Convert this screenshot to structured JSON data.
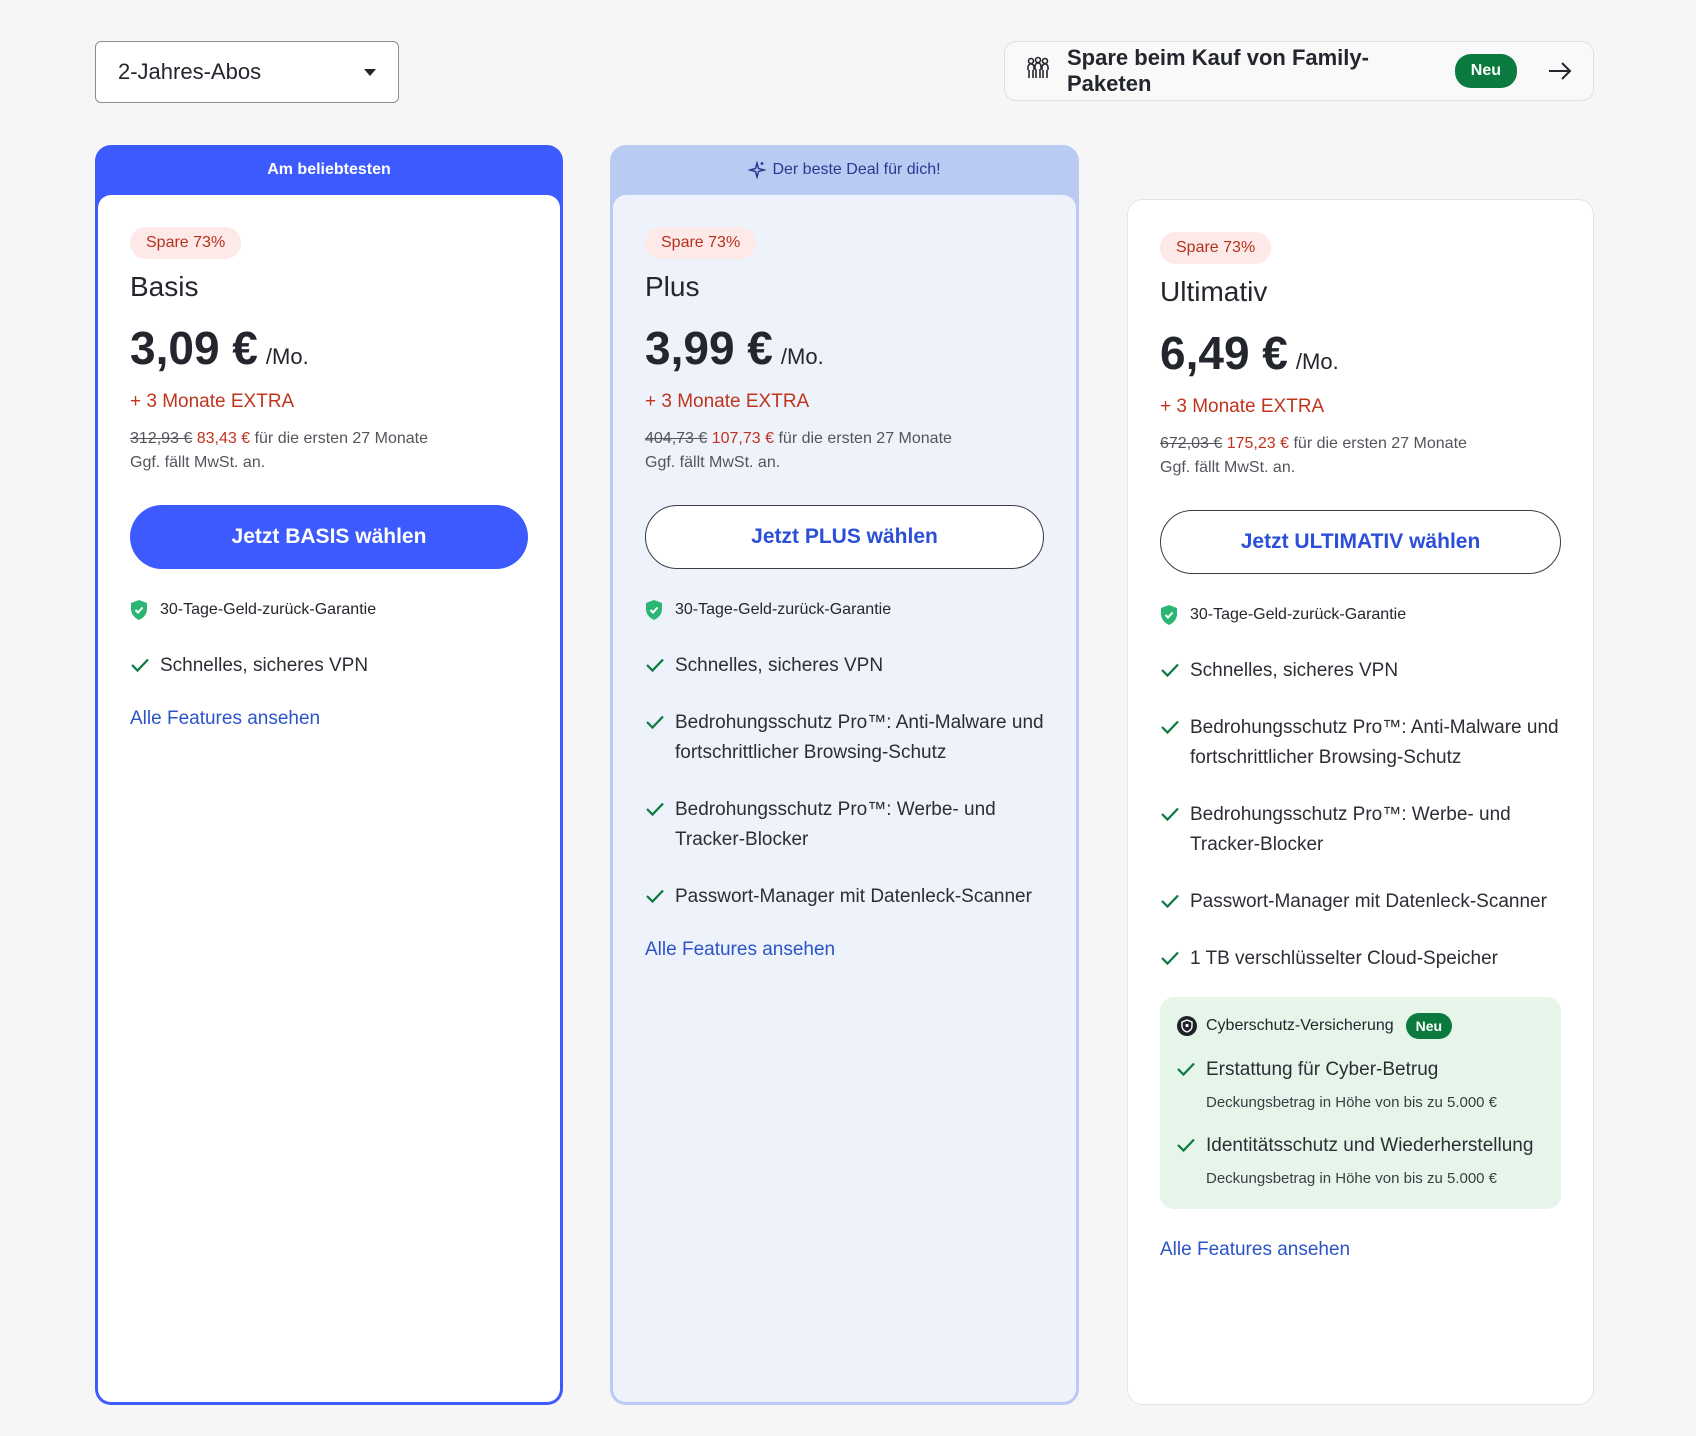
{
  "term_selector": {
    "value": "2-Jahres-Abos"
  },
  "family_banner": {
    "text": "Spare beim Kauf von Family-Paketen",
    "badge": "Neu"
  },
  "plans": [
    {
      "banner": "Am beliebtesten",
      "save": "Spare 73%",
      "name": "Basis",
      "price": "3,09 €",
      "per": "/Mo.",
      "extra": "+ 3 Monate EXTRA",
      "old_price": "312,93 €",
      "new_price": "83,43 €",
      "term_text": "für die ersten 27 Monate",
      "vat": "Ggf. fällt MwSt. an.",
      "cta": "Jetzt BASIS wählen",
      "guarantee": "30-Tage-Geld-zurück-Garantie",
      "features": [
        "Schnelles, sicheres VPN"
      ],
      "all_features": "Alle Features ansehen"
    },
    {
      "banner": "Der beste Deal für dich!",
      "save": "Spare 73%",
      "name": "Plus",
      "price": "3,99 €",
      "per": "/Mo.",
      "extra": "+ 3 Monate EXTRA",
      "old_price": "404,73 €",
      "new_price": "107,73 €",
      "term_text": "für die ersten 27 Monate",
      "vat": "Ggf. fällt MwSt. an.",
      "cta": "Jetzt PLUS wählen",
      "guarantee": "30-Tage-Geld-zurück-Garantie",
      "features": [
        "Schnelles, sicheres VPN",
        "Bedrohungsschutz Pro™: Anti-Malware und fortschrittlicher Browsing-Schutz",
        "Bedrohungsschutz Pro™: Werbe- und Tracker-Blocker",
        "Passwort-Manager mit Datenleck-Scanner"
      ],
      "all_features": "Alle Features ansehen"
    },
    {
      "save": "Spare 73%",
      "name": "Ultimativ",
      "price": "6,49 €",
      "per": "/Mo.",
      "extra": "+ 3 Monate EXTRA",
      "old_price": "672,03 €",
      "new_price": "175,23 €",
      "term_text": "für die ersten 27 Monate",
      "vat": "Ggf. fällt MwSt. an.",
      "cta": "Jetzt ULTIMATIV wählen",
      "guarantee": "30-Tage-Geld-zurück-Garantie",
      "features": [
        "Schnelles, sicheres VPN",
        "Bedrohungsschutz Pro™: Anti-Malware und fortschrittlicher Browsing-Schutz",
        "Bedrohungsschutz Pro™: Werbe- und Tracker-Blocker",
        "Passwort-Manager mit Datenleck-Scanner",
        "1 TB verschlüsselter Cloud-Speicher"
      ],
      "insurance": {
        "title": "Cyberschutz-Versicherung",
        "badge": "Neu",
        "items": [
          {
            "label": "Erstattung für Cyber-Betrug",
            "sub": "Deckungsbetrag in Höhe von bis zu 5.000 €"
          },
          {
            "label": "Identitätsschutz und Wiederherstellung",
            "sub": "Deckungsbetrag in Höhe von bis zu 5.000 €"
          }
        ]
      },
      "all_features": "Alle Features ansehen"
    }
  ],
  "icons": {
    "family": "family-icon",
    "arrow": "arrow-right-icon",
    "sparkle": "sparkle-icon",
    "shield": "shield-check-icon",
    "check": "check-icon",
    "insurance": "insurance-shield-icon"
  },
  "colors": {
    "primary": "#3d5afe",
    "accent_red": "#c0341d",
    "badge_green": "#0b7a3f",
    "check_green": "#0b7a3f",
    "plus_tint": "#b9cbf3"
  }
}
